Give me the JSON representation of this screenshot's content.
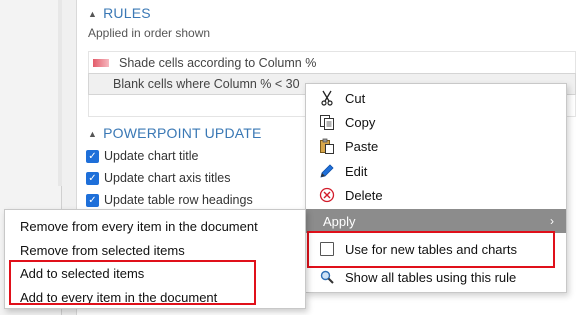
{
  "rules": {
    "heading": "RULES",
    "subtitle": "Applied in order shown",
    "items": [
      {
        "label": "Shade cells according to Column %"
      },
      {
        "label": "Blank cells where Column % < 30"
      }
    ]
  },
  "powerpoint": {
    "heading": "POWERPOINT UPDATE",
    "options": [
      {
        "label": "Update chart title",
        "checked": true
      },
      {
        "label": "Update chart axis titles",
        "checked": true
      },
      {
        "label": "Update table row headings",
        "checked": true
      }
    ]
  },
  "context_menu": {
    "items": [
      {
        "label": "Cut",
        "icon": "scissors-icon"
      },
      {
        "label": "Copy",
        "icon": "copy-icon"
      },
      {
        "label": "Paste",
        "icon": "paste-icon"
      },
      {
        "label": "Edit",
        "icon": "pencil-icon"
      },
      {
        "label": "Delete",
        "icon": "delete-icon"
      }
    ],
    "apply_label": "Apply",
    "use_for_new": "Use for new tables and charts",
    "show_all": "Show all tables using this rule"
  },
  "submenu": {
    "items": [
      {
        "label": "Remove from every item in the document"
      },
      {
        "label": "Remove from selected items"
      },
      {
        "label": "Add to selected items"
      },
      {
        "label": "Add to every item in the document"
      }
    ]
  },
  "colors": {
    "accent": "#3a78b5",
    "checkbox": "#1e6fd9",
    "highlight_box": "#e0101a",
    "apply_bg": "#8c8c8c"
  }
}
